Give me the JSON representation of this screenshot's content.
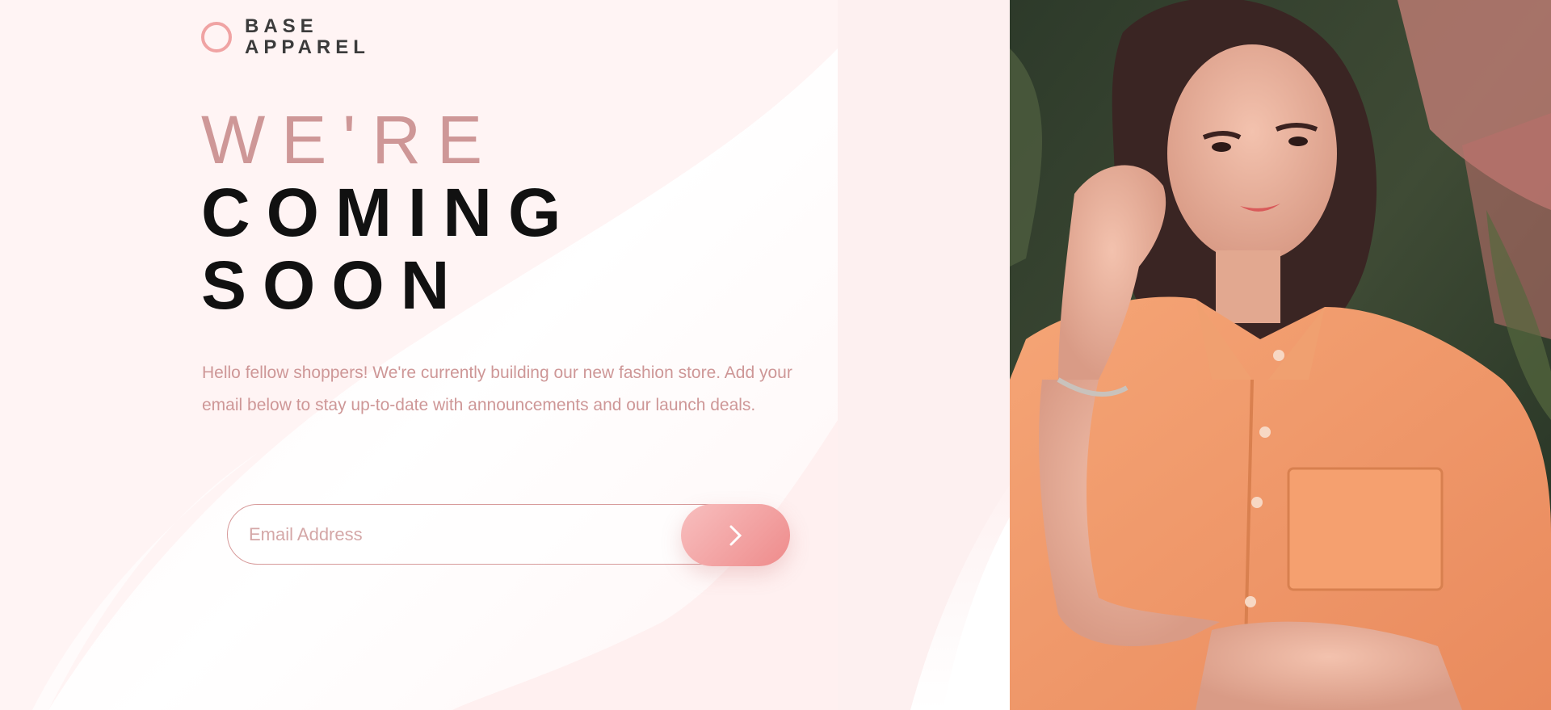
{
  "brand": {
    "line1": "BASE",
    "line2": "APPAREL",
    "logo_icon": "ring-icon",
    "accent_color": "#f0a3a3"
  },
  "hero": {
    "line_light": "WE'RE",
    "line_dark_1": "COMING",
    "line_dark_2": "SOON"
  },
  "intro_text": "Hello fellow shoppers! We're currently building our new fashion store. Add your email below to stay up-to-date with announcements and our launch deals.",
  "signup": {
    "email_placeholder": "Email Address",
    "submit_icon": "chevron-right-icon"
  },
  "photo": {
    "subject": "hero-image"
  },
  "colors": {
    "text_soft": "#ce9797",
    "text_dark": "#111111",
    "button_gradient_start": "#f8bfbf",
    "button_gradient_end": "#ee8b8b"
  }
}
